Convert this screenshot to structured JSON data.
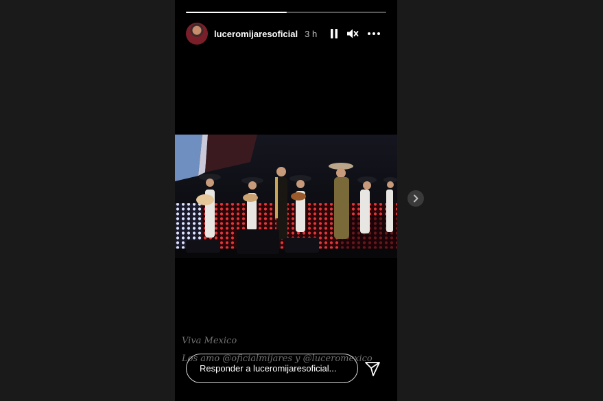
{
  "story": {
    "progress": 0.505,
    "username": "luceromijaresoficial",
    "time": "3 h",
    "controls": {
      "pause_icon": "pause-icon",
      "mute_icon": "speaker-muted-icon",
      "more_icon": "more-dots-icon"
    },
    "captions": [
      "Viva Mexico",
      "Los amo @oficialmijares  y @luceromexico"
    ],
    "reply_placeholder": "Responder a luceromijaresoficial...",
    "send_icon": "send-icon"
  },
  "navigation": {
    "next_icon": "chevron-right-icon"
  },
  "colors": {
    "page_background": "#1a1a1a",
    "story_background": "#000000",
    "stage_lights": "#d42a2a"
  }
}
